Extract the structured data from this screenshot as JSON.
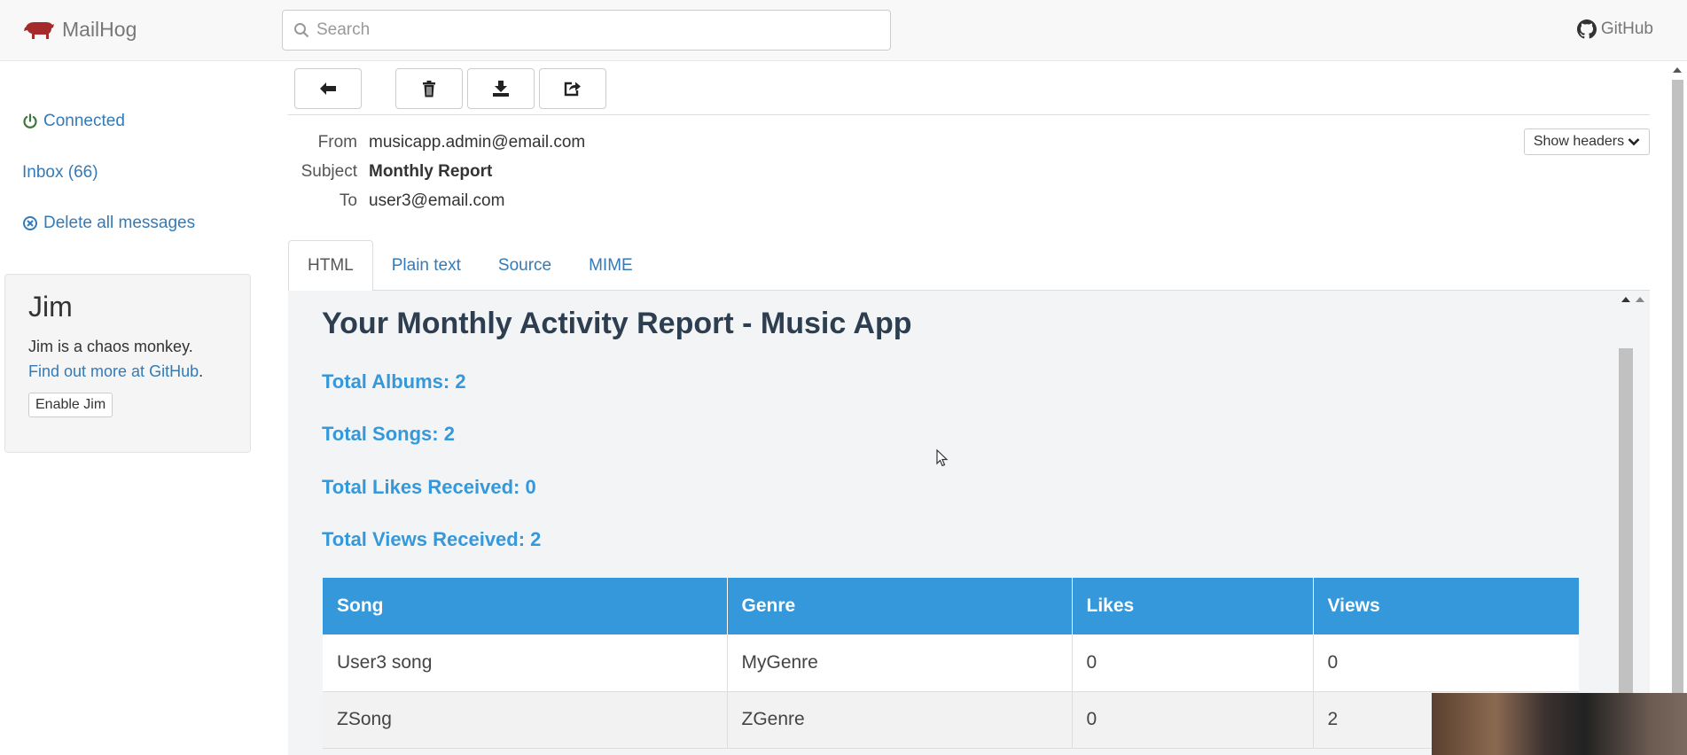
{
  "navbar": {
    "brand": "MailHog",
    "search_placeholder": "Search",
    "github": "GitHub"
  },
  "sidebar": {
    "connected": "Connected",
    "inbox": "Inbox (66)",
    "delete_all": "Delete all messages"
  },
  "jim": {
    "title": "Jim",
    "text": "Jim is a chaos monkey.",
    "link": "Find out more at GitHub",
    "period": ".",
    "button": "Enable Jim"
  },
  "message": {
    "from_label": "From",
    "from": "musicapp.admin@email.com",
    "subject_label": "Subject",
    "subject": "Monthly Report",
    "to_label": "To",
    "to": "user3@email.com",
    "show_headers": "Show headers"
  },
  "tabs": [
    "HTML",
    "Plain text",
    "Source",
    "MIME"
  ],
  "email": {
    "heading": "Your Monthly Activity Report - Music App",
    "stats": [
      "Total Albums: 2",
      "Total Songs: 2",
      "Total Likes Received: 0",
      "Total Views Received: 2"
    ],
    "table": {
      "headers": [
        "Song",
        "Genre",
        "Likes",
        "Views"
      ],
      "rows": [
        [
          "User3 song",
          "MyGenre",
          "0",
          "0"
        ],
        [
          "ZSong",
          "ZGenre",
          "0",
          "2"
        ]
      ]
    }
  },
  "icons": {
    "brand": "pig-icon",
    "search": "search-icon",
    "github": "github-icon",
    "connected": "power-icon",
    "delete": "circle-x-icon",
    "back": "arrow-left-icon",
    "trash": "trash-icon",
    "download": "download-icon",
    "release": "share-icon",
    "show_headers": "chevron-down-icon"
  },
  "colors": {
    "link": "#337ab7",
    "connected": "#3c763d",
    "table_header": "#3498db",
    "heading": "#2c3e50",
    "brand_icon": "#a52a2a"
  }
}
